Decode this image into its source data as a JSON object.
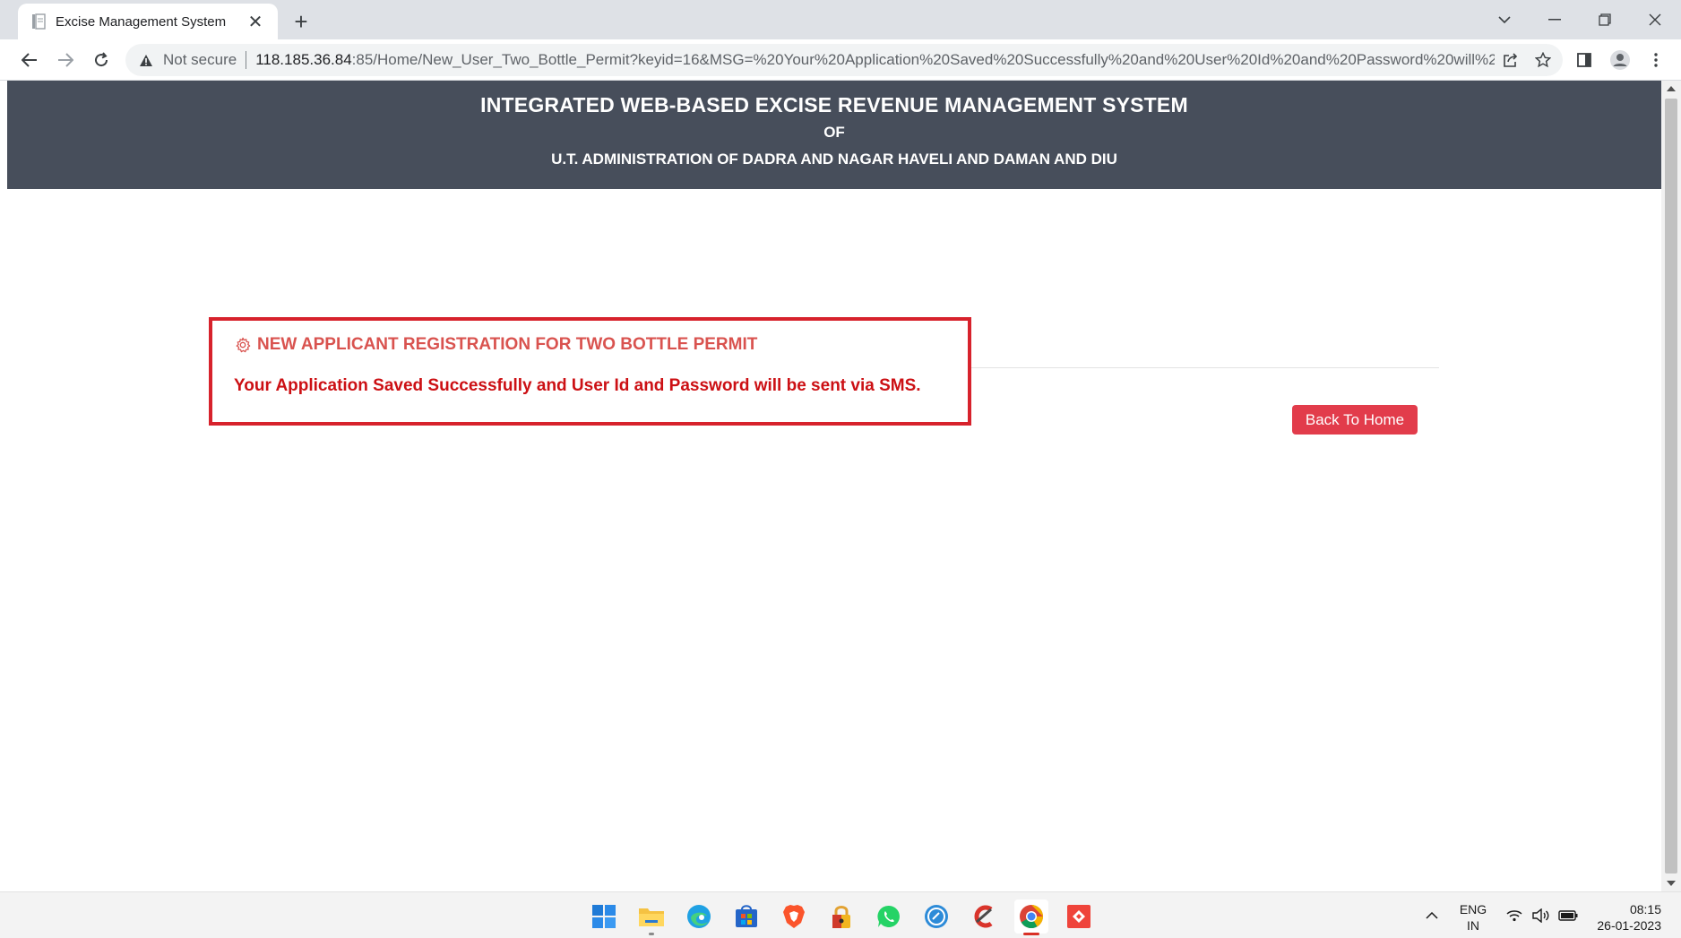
{
  "browser": {
    "tab_title": "Excise Management System",
    "close_glyph": "✕",
    "new_tab_glyph": "+",
    "security_label": "Not secure",
    "url_host": "118.185.36.84",
    "url_rest": ":85/Home/New_User_Two_Bottle_Permit?keyid=16&MSG=%20Your%20Application%20Saved%20Successfully%20and%20User%20Id%20and%20Password%20will%20b..."
  },
  "header": {
    "title": "INTEGRATED WEB-BASED EXCISE REVENUE MANAGEMENT SYSTEM",
    "of": "OF",
    "subtitle": "U.T. ADMINISTRATION OF DADRA AND NAGAR HAVELI AND DAMAN AND DIU"
  },
  "main": {
    "section_title": "NEW APPLICANT REGISTRATION FOR TWO BOTTLE PERMIT",
    "success_message": "Your Application Saved Successfully and User Id and Password will be sent via SMS.",
    "back_button": "Back To Home"
  },
  "taskbar": {
    "lang_primary": "ENG",
    "lang_secondary": "IN",
    "time": "08:15",
    "date": "26-01-2023"
  },
  "colors": {
    "header_bg": "#474e5b",
    "title_red": "#d9534f",
    "message_red": "#cc1014",
    "highlight_border": "#d7222c",
    "button_bg": "#e23c4b"
  }
}
